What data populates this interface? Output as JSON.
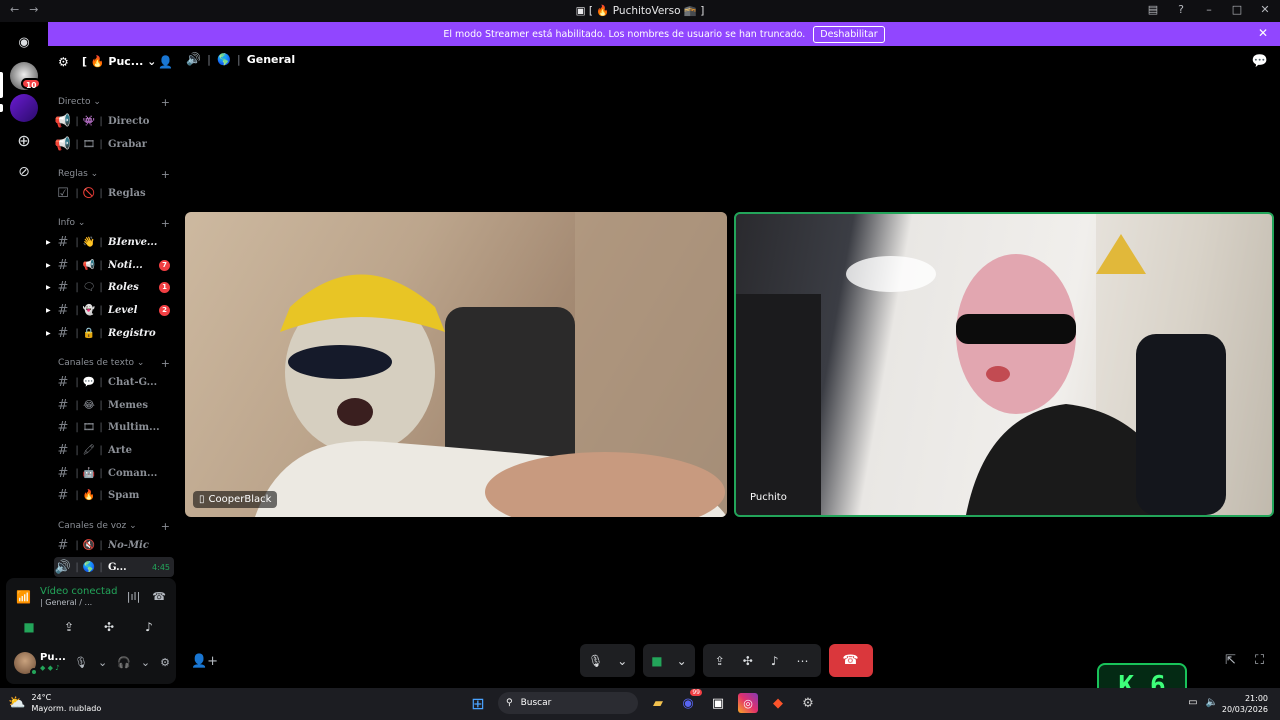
{
  "window": {
    "title": "[ 🔥 PuchitoVerso 🕋 ]",
    "back": "←",
    "forward": "→"
  },
  "banner": {
    "text": "El modo Streamer está habilitado. Los nombres de usuario se han truncado.",
    "button": "Deshabilitar"
  },
  "server": {
    "name": "Puc...",
    "badge": "10"
  },
  "categories": {
    "directo": "Directo",
    "reglas": "Reglas",
    "info": "Info",
    "texto": "Canales de texto",
    "voz": "Canales de voz"
  },
  "channels": {
    "directo": "Directo",
    "grabar": "Grabar",
    "reglas": "Reglas",
    "bienvenida": "BIenve...",
    "noticias": "Noti...",
    "roles": "Roles",
    "level": "Level",
    "registro": "Registro",
    "chat": "Chat-G...",
    "memes": "Memes",
    "multimedia": "Multim...",
    "arte": "Arte",
    "comandos": "Coman...",
    "spam": "Spam",
    "nomic": "No-Mic",
    "general_short": "G...",
    "general_time": "4:45"
  },
  "badges": {
    "noticias": "7",
    "roles": "1",
    "level": "2"
  },
  "voice_panel": {
    "status": "Vídeo conectado",
    "sub": "| General / ..."
  },
  "user": {
    "name": "Pu...",
    "status": "◆ ◆ ♪"
  },
  "header": {
    "channel": "General"
  },
  "participants": [
    {
      "name": "CooperBlack"
    },
    {
      "name": "Puchito"
    }
  ],
  "widget": {
    "k": "K",
    "num": "6"
  },
  "taskbar": {
    "temp": "24°C",
    "weather": "Mayorm. nublado",
    "search": "Buscar",
    "time": "21:00",
    "date": "20/03/2026",
    "discord_badge": "99"
  },
  "colors": {
    "accent": "#9146ff",
    "online": "#23a55a",
    "danger": "#da373c"
  }
}
